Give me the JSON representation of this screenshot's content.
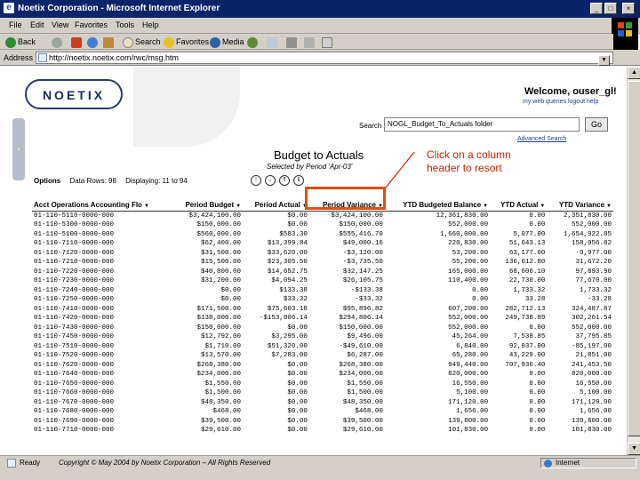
{
  "window": {
    "title": "Noetix Corporation - Microsoft Internet Explorer",
    "minimize": "_",
    "maximize": "□",
    "close": "×"
  },
  "menu": [
    "File",
    "Edit",
    "View",
    "Favorites",
    "Tools",
    "Help"
  ],
  "throbber_text": "",
  "toolbar": {
    "back": "Back",
    "search": "Search",
    "favorites": "Favorites",
    "media": "Media"
  },
  "address": {
    "label": "Address",
    "url": "http://noetix.noetix.com/rwc/msg.htm"
  },
  "page": {
    "logo": "NOETIX",
    "welcome": "Welcome, ouser_gl!",
    "sublinks": "my web queries  logout  help",
    "search_label": "Search",
    "search_value": "NOGL_Budget_To_Actuals folder",
    "go": "Go",
    "advanced_search": "Advanced Search",
    "report_title": "Budget to Actuals",
    "report_subtitle": "Selected by Period 'Apr-03'",
    "callout_line1": "Click on a column",
    "callout_line2": "header to resort",
    "options": "Options",
    "data_rows": "Data Rows: 98",
    "displaying": "Displaying: 11 to 94"
  },
  "table": {
    "headers": [
      "Acct Operations Accounting Flo",
      "Period Budget",
      "Period Actual",
      "Period Variance",
      "YTD Budgeted Balance",
      "YTD Actual",
      "YTD Variance"
    ],
    "rows": [
      [
        "01-110-5110-0000-000",
        "$3,424,100.00",
        "$0.00",
        "$3,424,100.00",
        "12,361,830.00",
        "0.00",
        "2,351,830.00"
      ],
      [
        "01-110-5300-0000-000",
        "$150,000.00",
        "$0.00",
        "$150,000.00",
        "552,000.00",
        "0.00",
        "552,000.00"
      ],
      [
        "01-110-5100-0000-000",
        "$560,000.00",
        "$583.30",
        "$555,416.70",
        "1,660,000.00",
        "5,077.00",
        "1,654,922.85"
      ],
      [
        "01-110-7110-0000-000",
        "$62,400.00",
        "$13,399.84",
        "$49,000.16",
        "220,830.00",
        "51,643.13",
        "158,956.82"
      ],
      [
        "01-110-7120-0000-000",
        "$31,500.00",
        "$33,620.00",
        "-$3,120.00",
        "53,200.00",
        "63,177.00",
        "-9,977.00"
      ],
      [
        "01-110-7210-0000-000",
        "$15,500.00",
        "$23,305.50",
        "-$3,735.50",
        "55,200.00",
        "136,612.80",
        "31,672.20"
      ],
      [
        "01-110-7220-0000-000",
        "$40,800.00",
        "$14,652.75",
        "$32,147.25",
        "165,000.00",
        "68,606.10",
        "97,893.90"
      ],
      [
        "01-110-7230-0000-000",
        "$31,200.00",
        "$4,094.25",
        "$26,105.75",
        "110,400.00",
        "22,730.00",
        "77,670.00"
      ],
      [
        "01-110-7240-0000-000",
        "$0.00",
        "$133.38",
        "-$133.38",
        "0.00",
        "1,733.32",
        "1,733.32"
      ],
      [
        "01-110-7250-0000-000",
        "$0.00",
        "$33.32",
        "-$33.32",
        "0.00",
        "33.28",
        "-33.28"
      ],
      [
        "01-110-7410-0000-000",
        "$171,500.00",
        "$75,603.18",
        "$95,896.82",
        "607,200.00",
        "282,712.13",
        "324,487.87"
      ],
      [
        "01-110-7420-0000-000",
        "$138,000.00",
        "-$153,806.14",
        "$294,806.14",
        "552,000.00",
        "249,738.89",
        "302,261.54"
      ],
      [
        "01-110-7430-0000-000",
        "$150,000.00",
        "$0.00",
        "$150,000.00",
        "552,000.00",
        "0.00",
        "552,000.00"
      ],
      [
        "01-110-7450-0000-000",
        "$12,792.00",
        "$3,295.00",
        "$9,496.00",
        "45,264.00",
        "7,538.85",
        "37,795.85"
      ],
      [
        "01-110-7510-0000-000",
        "$1,710.00",
        "$51,320.00",
        "-$49,610.00",
        "6,840.00",
        "92,037.00",
        "-85,197.00"
      ],
      [
        "01-110-7520-0000-000",
        "$13,570.00",
        "$7,283.00",
        "$6,287.00",
        "65,280.00",
        "43,229.00",
        "21,851.00"
      ],
      [
        "01-110-7620-0000-000",
        "$268,380.00",
        "$0.00",
        "$268,380.00",
        "949,440.00",
        "707,936.40",
        "241,453.50"
      ],
      [
        "01-110-7640-0000-000",
        "$234,000.00",
        "$0.00",
        "$234,000.00",
        "820,000.00",
        "0.00",
        "820,000.00"
      ],
      [
        "01-110-7650-0000-000",
        "$1,550.00",
        "$0.00",
        "$1,550.00",
        "16,550.00",
        "0.00",
        "16,550.00"
      ],
      [
        "01-110-7660-0000-000",
        "$1,500.00",
        "$0.00",
        "$1,500.00",
        "5,100.00",
        "0.00",
        "5,100.00"
      ],
      [
        "01-110-7670-0000-000",
        "$48,350.00",
        "$0.00",
        "$48,350.00",
        "171,120.00",
        "0.00",
        "171,120.00"
      ],
      [
        "01-110-7680-0000-000",
        "$468.00",
        "$0.00",
        "$468.00",
        "1,656.00",
        "0.00",
        "1,656.00"
      ],
      [
        "01-110-7690-0000-000",
        "$39,500.00",
        "$0.00",
        "$39,500.00",
        "139,800.00",
        "0.00",
        "139,800.00"
      ],
      [
        "01-110-7710-0000-000",
        "$29,610.00",
        "$0.00",
        "$29,610.00",
        "101,830.00",
        "0.00",
        "101,830.00"
      ]
    ]
  },
  "status": {
    "ready": "Ready",
    "copyright": "Copyright © May 2004 by Noetix Corporation – All Rights Reserved",
    "zone": "Internet"
  }
}
